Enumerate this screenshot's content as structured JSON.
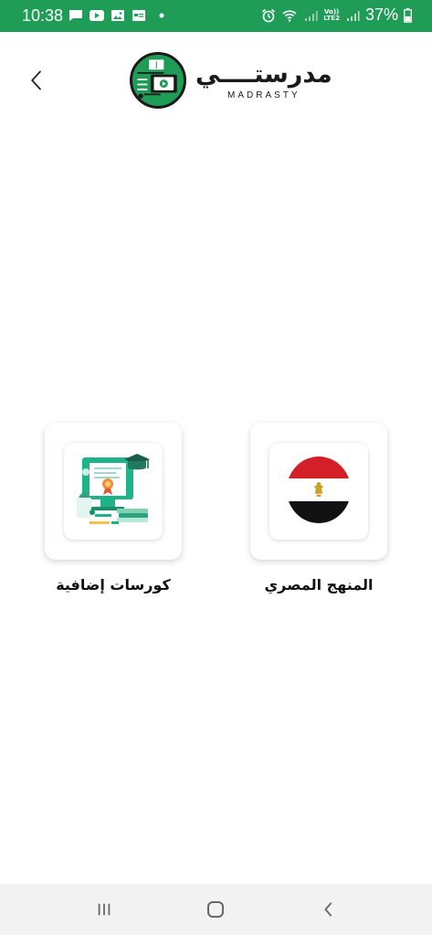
{
  "status_bar": {
    "time": "10:38",
    "battery": "37%",
    "network": "LTE2",
    "volte": "Vo))",
    "background_color": "#1f9d57"
  },
  "header": {
    "back_icon": "chevron-left-icon",
    "logo_arabic": "مدرستــــي",
    "logo_latin": "MADRASTY"
  },
  "cards": [
    {
      "label": "كورسات إضافية",
      "icon": "certificate-illustration"
    },
    {
      "label": "المنهج المصري",
      "icon": "egypt-flag"
    }
  ],
  "nav_bar": {
    "recents_icon": "recents-icon",
    "home_icon": "home-icon",
    "back_icon": "back-icon"
  },
  "colors": {
    "brand_green": "#1f9d57",
    "flag_red": "#d21f28",
    "flag_black": "#121212"
  }
}
